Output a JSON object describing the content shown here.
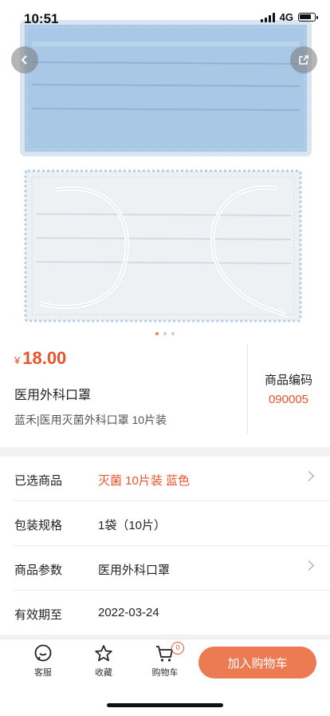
{
  "status": {
    "time": "10:51",
    "network": "4G"
  },
  "product": {
    "currency_symbol": "¥",
    "price": "18.00",
    "name": "医用外科口罩",
    "subtitle": "蓝禾|医用灭菌外科口罩 10片装",
    "code_label": "商品编码",
    "code_value": "090005"
  },
  "carousel": {
    "count": 3,
    "active": 0
  },
  "specs": [
    {
      "label": "已选商品",
      "value": "灭菌 10片装 蓝色",
      "accent": true,
      "chevron": true
    },
    {
      "label": "包装规格",
      "value": "1袋（10片）",
      "accent": false,
      "chevron": false
    },
    {
      "label": "商品参数",
      "value": "医用外科口罩",
      "accent": false,
      "chevron": true
    },
    {
      "label": "有效期至",
      "value": "2022-03-24",
      "accent": false,
      "chevron": false
    }
  ],
  "bottom": {
    "service": "客服",
    "favorite": "收藏",
    "cart": "购物车",
    "cart_count": "0",
    "add_to_cart": "加入购物车"
  },
  "colors": {
    "accent": "#e8532b",
    "button": "#ec7b54",
    "mask_blue": "#a9c8e6"
  },
  "icons": [
    "back-icon",
    "share-icon",
    "chat-icon",
    "star-icon",
    "cart-icon"
  ]
}
